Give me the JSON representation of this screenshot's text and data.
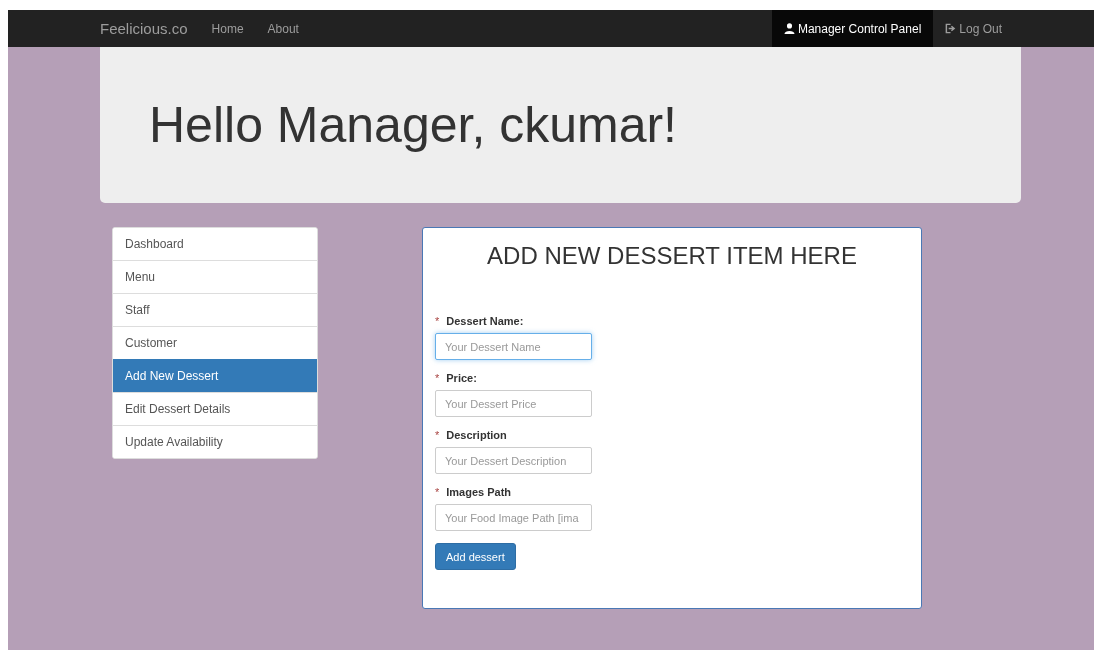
{
  "navbar": {
    "brand": "Feelicious.co",
    "links": [
      {
        "label": "Home",
        "selected": false
      },
      {
        "label": "About",
        "selected": false
      }
    ],
    "right_links": [
      {
        "label": "Manager Control Panel",
        "kind": "user",
        "selected": true
      },
      {
        "label": "Log Out",
        "kind": "logout",
        "selected": false
      }
    ]
  },
  "jumbotron": {
    "heading": "Hello Manager, ckumar!"
  },
  "sidebar": {
    "items": [
      {
        "label": "Dashboard",
        "selected": false
      },
      {
        "label": "Menu",
        "selected": false
      },
      {
        "label": "Staff",
        "selected": false
      },
      {
        "label": "Customer",
        "selected": false
      },
      {
        "label": "Add New Dessert",
        "selected": true
      },
      {
        "label": "Edit Dessert Details",
        "selected": false
      },
      {
        "label": "Update Availability",
        "selected": false
      }
    ]
  },
  "form": {
    "title": "ADD NEW DESSERT ITEM HERE",
    "fields": [
      {
        "required_mark": "*",
        "label": "Dessert Name:",
        "placeholder": "Your Dessert Name",
        "focused": true
      },
      {
        "required_mark": "*",
        "label": "Price:",
        "placeholder": "Your Dessert Price",
        "focused": false
      },
      {
        "required_mark": "*",
        "label": "Description",
        "placeholder": "Your Dessert Description",
        "focused": false
      },
      {
        "required_mark": "*",
        "label": "Images Path",
        "placeholder": "Your Food Image Path [ima",
        "focused": false
      }
    ],
    "submit": "Add dessert"
  }
}
